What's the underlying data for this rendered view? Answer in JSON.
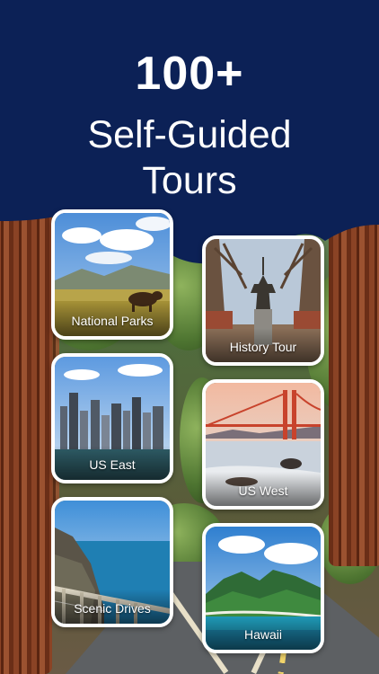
{
  "header": {
    "count": "100+",
    "title_line1": "Self-Guided",
    "title_line2": "Tours"
  },
  "tours": [
    {
      "label": "National Parks",
      "icon": "national-parks-photo"
    },
    {
      "label": "History Tour",
      "icon": "history-tour-photo"
    },
    {
      "label": "US East",
      "icon": "us-east-photo"
    },
    {
      "label": "US West",
      "icon": "us-west-photo"
    },
    {
      "label": "Scenic Drives",
      "icon": "scenic-drives-photo"
    },
    {
      "label": "Hawaii",
      "icon": "hawaii-photo"
    }
  ],
  "colors": {
    "header_navy": "#0c2156",
    "card_border": "#ffffff",
    "label_text": "#ffffff"
  }
}
